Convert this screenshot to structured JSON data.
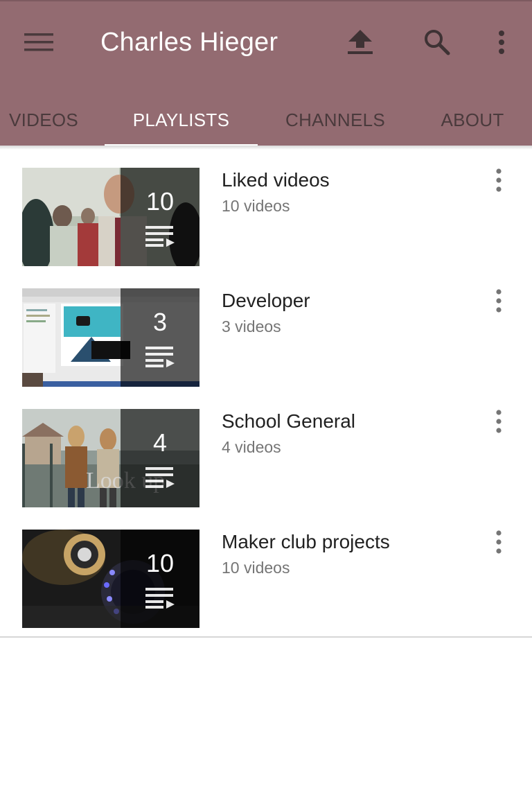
{
  "header": {
    "title": "Charles Hieger",
    "background_color": "#936b71",
    "icons": [
      "hamburger-menu-icon",
      "upload-icon",
      "search-icon",
      "more-vertical-icon"
    ]
  },
  "tabs": [
    {
      "label": "VIDEOS",
      "active": false
    },
    {
      "label": "PLAYLISTS",
      "active": true
    },
    {
      "label": "CHANNELS",
      "active": false
    },
    {
      "label": "ABOUT",
      "active": false
    }
  ],
  "playlists": [
    {
      "title": "Liked videos",
      "subtitle": "10 videos",
      "count": "10"
    },
    {
      "title": "Developer",
      "subtitle": "3 videos",
      "count": "3"
    },
    {
      "title": "School General",
      "subtitle": "4 videos",
      "count": "4"
    },
    {
      "title": "Maker club projects",
      "subtitle": "10 videos",
      "count": "10"
    }
  ]
}
